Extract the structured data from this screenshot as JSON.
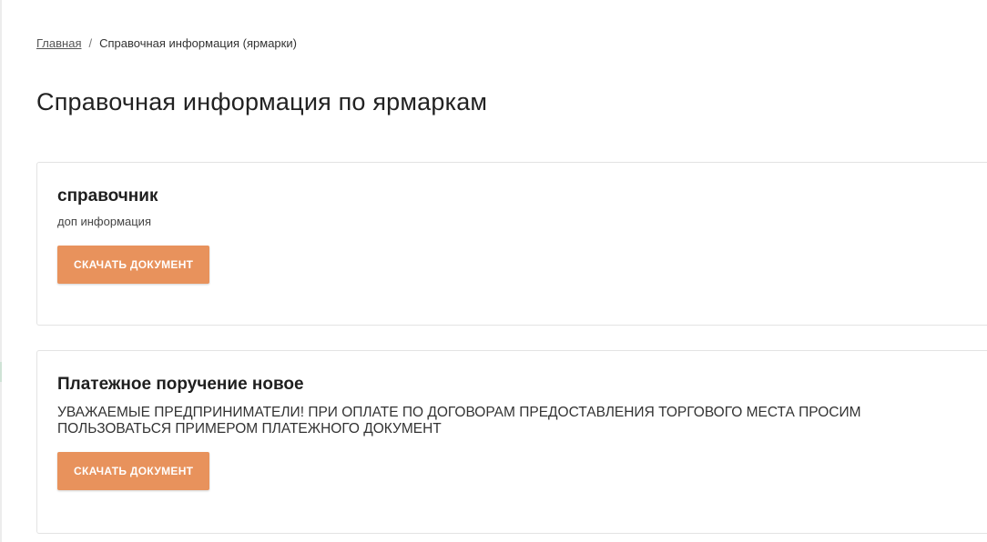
{
  "breadcrumb": {
    "home_label": "Главная",
    "separator": "/",
    "current_label": "Справочная информация (ярмарки)"
  },
  "page": {
    "title": "Справочная информация по ярмаркам"
  },
  "documents": [
    {
      "title": "справочник",
      "description": "доп информация",
      "button_label": "СКАЧАТЬ ДОКУМЕНТ"
    },
    {
      "title": "Платежное поручение новое",
      "description": "УВАЖАЕМЫЕ ПРЕДПРИНИМАТЕЛИ! ПРИ ОПЛАТЕ ПО ДОГОВОРАМ ПРЕДОСТАВЛЕНИЯ ТОРГОВОГО МЕСТА ПРОСИМ ПОЛЬЗОВАТЬСЯ ПРИМЕРОМ ПЛАТЕЖНОГО ДОКУМЕНТ",
      "button_label": "СКАЧАТЬ ДОКУМЕНТ"
    }
  ],
  "colors": {
    "button_bg": "#e8925c",
    "button_text": "#ffffff",
    "card_border": "#e3e3e3"
  }
}
